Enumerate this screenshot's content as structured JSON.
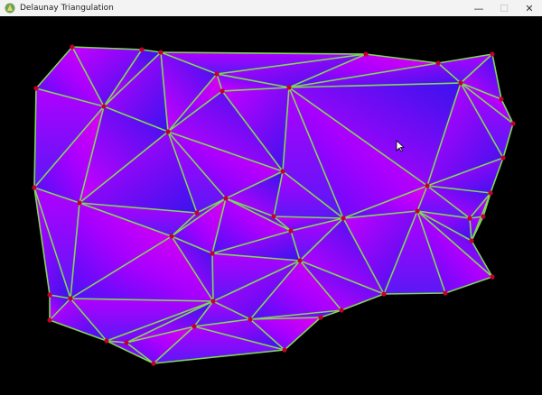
{
  "window": {
    "title": "Delaunay Triangulation",
    "icon": "python-feather-icon",
    "controls": {
      "minimize": "—",
      "maximize": "☐",
      "close": "✕"
    }
  },
  "colors": {
    "background": "#000000",
    "edge": "#7ed957",
    "vertex": "#c2002e",
    "fill_a": "#c800ff",
    "fill_b": "#3b14f0"
  }
}
